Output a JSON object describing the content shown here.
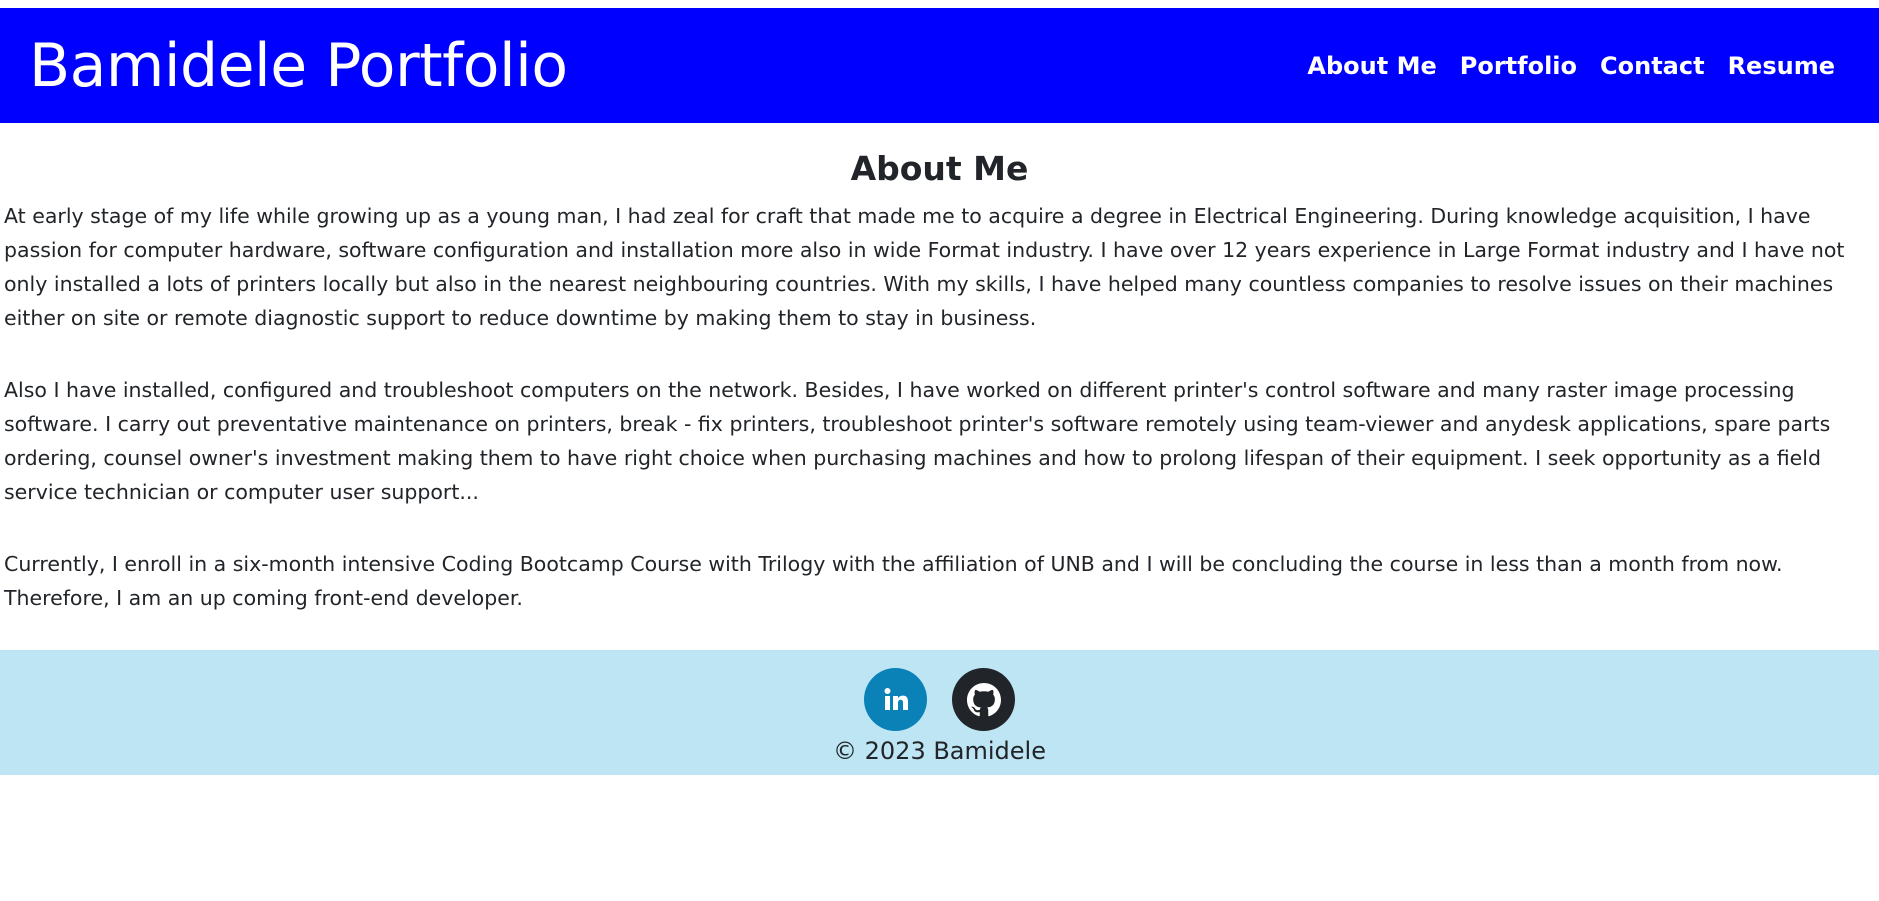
{
  "header": {
    "brand": "Bamidele Portfolio",
    "nav": [
      "About Me",
      "Portfolio",
      "Contact",
      "Resume"
    ]
  },
  "main": {
    "heading": "About Me",
    "paragraphs": [
      "At early stage of my life while growing up as a young man, I had zeal for craft that made me to acquire a degree in Electrical Engineering. During knowledge acquisition, I have passion for computer hardware, software configuration and installation more also in wide Format industry. I have over 12 years experience in Large Format industry and I have not only installed a lots of printers locally but also in the nearest neighbouring countries. With my skills, I have helped many countless companies to resolve issues on their machines either on site or remote diagnostic support to reduce downtime by making them to stay in business.",
      "Also I have installed, configured and troubleshoot computers on the network. Besides, I have worked on different printer's control software and many raster image processing software. I carry out preventative maintenance on printers, break - fix printers, troubleshoot printer's software remotely using team-viewer and anydesk applications, spare parts ordering, counsel owner's investment making them to have right choice when purchasing machines and how to prolong lifespan of their equipment. I seek opportunity as a field service technician or computer user support...",
      "Currently, I enroll in a six-month intensive Coding Bootcamp Course with Trilogy with the affiliation of UNB and I will be concluding the course in less than a month from now. Therefore, I am an up coming front-end developer."
    ]
  },
  "footer": {
    "social": [
      {
        "icon": "linkedin-icon",
        "color": "#0a82b8"
      },
      {
        "icon": "github-icon",
        "color": "#212529"
      }
    ],
    "copyright": "© 2023 Bamidele"
  },
  "colors": {
    "header_bg": "#0000ff",
    "footer_bg": "#bee5f4",
    "text": "#212529"
  }
}
